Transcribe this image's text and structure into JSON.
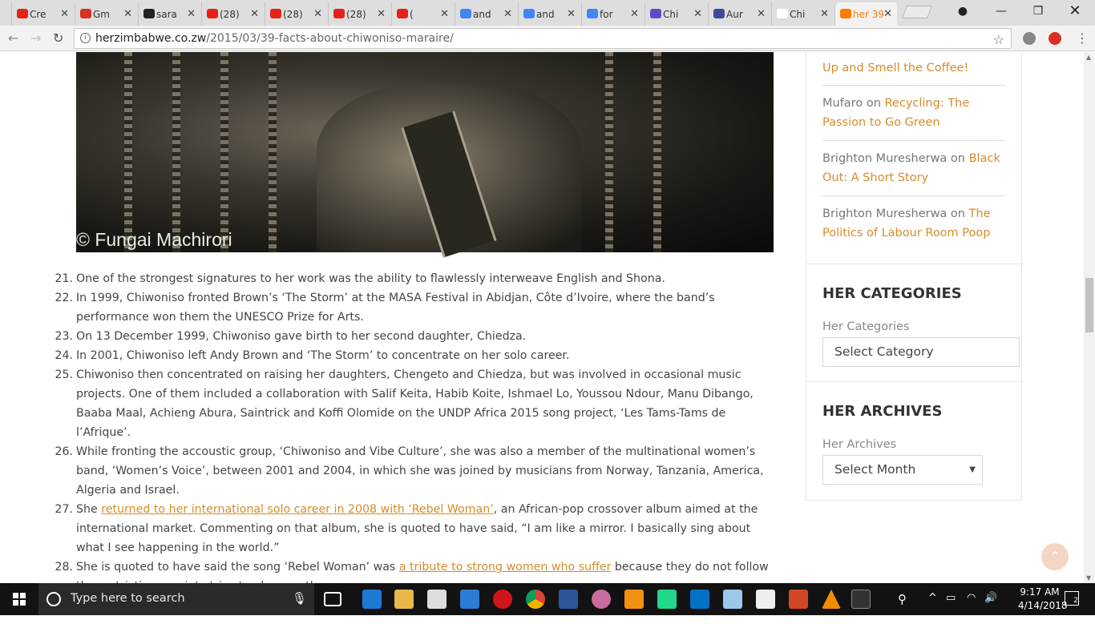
{
  "browser": {
    "tabs": [
      {
        "label": "Cre",
        "icon": "youtube-icon",
        "color": "#e62117"
      },
      {
        "label": "Gm",
        "icon": "gmail-icon",
        "color": "#d93025"
      },
      {
        "label": "sara",
        "icon": "github-icon",
        "color": "#222222"
      },
      {
        "label": "(28)",
        "icon": "youtube-icon",
        "color": "#e62117"
      },
      {
        "label": "(28)",
        "icon": "youtube-icon",
        "color": "#e62117"
      },
      {
        "label": "(28)",
        "icon": "youtube-icon",
        "color": "#e62117"
      },
      {
        "label": "(",
        "icon": "youtube-icon",
        "color": "#e62117"
      },
      {
        "label": "and",
        "icon": "google-icon",
        "color": "#4285f4"
      },
      {
        "label": "and",
        "icon": "google-icon",
        "color": "#4285f4"
      },
      {
        "label": "for",
        "icon": "google-icon",
        "color": "#4285f4"
      },
      {
        "label": "Chi",
        "icon": "music-icon",
        "color": "#5a4fc0"
      },
      {
        "label": "Aur",
        "icon": "s-icon",
        "color": "#3b4a9c"
      },
      {
        "label": "Chi",
        "icon": "wikipedia-icon",
        "color": "#ffffff"
      },
      {
        "label": "her 39",
        "icon": "site-icon",
        "color": "#ff7b00",
        "active": true
      }
    ],
    "url_host": "herzimbabwe.co.zw",
    "url_path": "/2015/03/39-facts-about-chiwoniso-maraire/"
  },
  "article": {
    "photo_credit": "© Fungai Machirori",
    "facts": [
      {
        "n": "21.",
        "parts": [
          {
            "t": "One of the strongest signatures to her work was the ability to flawlessly interweave English and Shona."
          }
        ]
      },
      {
        "n": "22.",
        "parts": [
          {
            "t": "In 1999, Chiwoniso fronted Brown’s ‘The Storm’ at the MASA Festival in Abidjan, Côte d’Ivoire, where the band’s performance won them the UNESCO Prize for Arts."
          }
        ]
      },
      {
        "n": "23.",
        "parts": [
          {
            "t": "On 13 December 1999, Chiwoniso gave birth to her second daughter, Chiedza."
          }
        ]
      },
      {
        "n": "24.",
        "parts": [
          {
            "t": "In 2001, Chiwoniso left Andy Brown and ‘The Storm’ to concentrate on her solo career."
          }
        ]
      },
      {
        "n": "25.",
        "parts": [
          {
            "t": "Chiwoniso then concentrated on raising her daughters, Chengeto and Chiedza, but was involved in occasional music projects. One of them included a collaboration with Salif Keita, Habib Koite, Ishmael Lo, Youssou Ndour, Manu Dibango, Baaba Maal, Achieng Abura, Saintrick and Koffi Olomide on the UNDP Africa 2015 song project, ‘Les Tams-Tams de l’Afrique’."
          }
        ]
      },
      {
        "n": "26.",
        "parts": [
          {
            "t": "While fronting the accoustic group, ‘Chiwoniso and Vibe Culture’, she was also a member of the multinational women’s band, ‘Women’s Voice’, between 2001 and 2004, in which she was joined by musicians from Norway, Tanzania, America, Algeria and Israel."
          }
        ]
      },
      {
        "n": "27.",
        "parts": [
          {
            "t": "She "
          },
          {
            "t": "returned to her international solo career in 2008 with ‘Rebel Woman’",
            "link": true
          },
          {
            "t": ", an African-pop crossover album aimed at the international market. Commenting on that album, she is quoted to have said, “I am like a mirror. I basically sing about what I see happening in the world.”"
          }
        ]
      },
      {
        "n": "28.",
        "parts": [
          {
            "t": "She is quoted to have said the song ‘Rebel Woman’ was "
          },
          {
            "t": "a tribute to strong women who suffer",
            "link": true
          },
          {
            "t": " because they do not follow the restrictions society tries to place on them."
          }
        ]
      }
    ]
  },
  "sidebar": {
    "comments": [
      {
        "author": "",
        "title": "Up and Smell the Coffee!"
      },
      {
        "author": "Mufaro",
        "on": " on ",
        "title": "Recycling: The Passion to Go Green"
      },
      {
        "author": "Brighton Muresherwa",
        "on": " on ",
        "title": "Black Out: A Short Story"
      },
      {
        "author": "Brighton Muresherwa",
        "on": " on ",
        "title": "The Politics of Labour Room Poop"
      }
    ],
    "categories_title": "HER CATEGORIES",
    "categories_label": "Her Categories",
    "categories_value": "Select Category",
    "archives_title": "HER ARCHIVES",
    "archives_label": "Her Archives",
    "archives_value": "Select Month"
  },
  "taskbar": {
    "search_placeholder": "Type here to search",
    "time": "9:17 AM",
    "date": "4/14/2018",
    "notifications": "2"
  },
  "colors": {
    "link": "#d58c2b",
    "active_tab": "#ff7b00"
  }
}
